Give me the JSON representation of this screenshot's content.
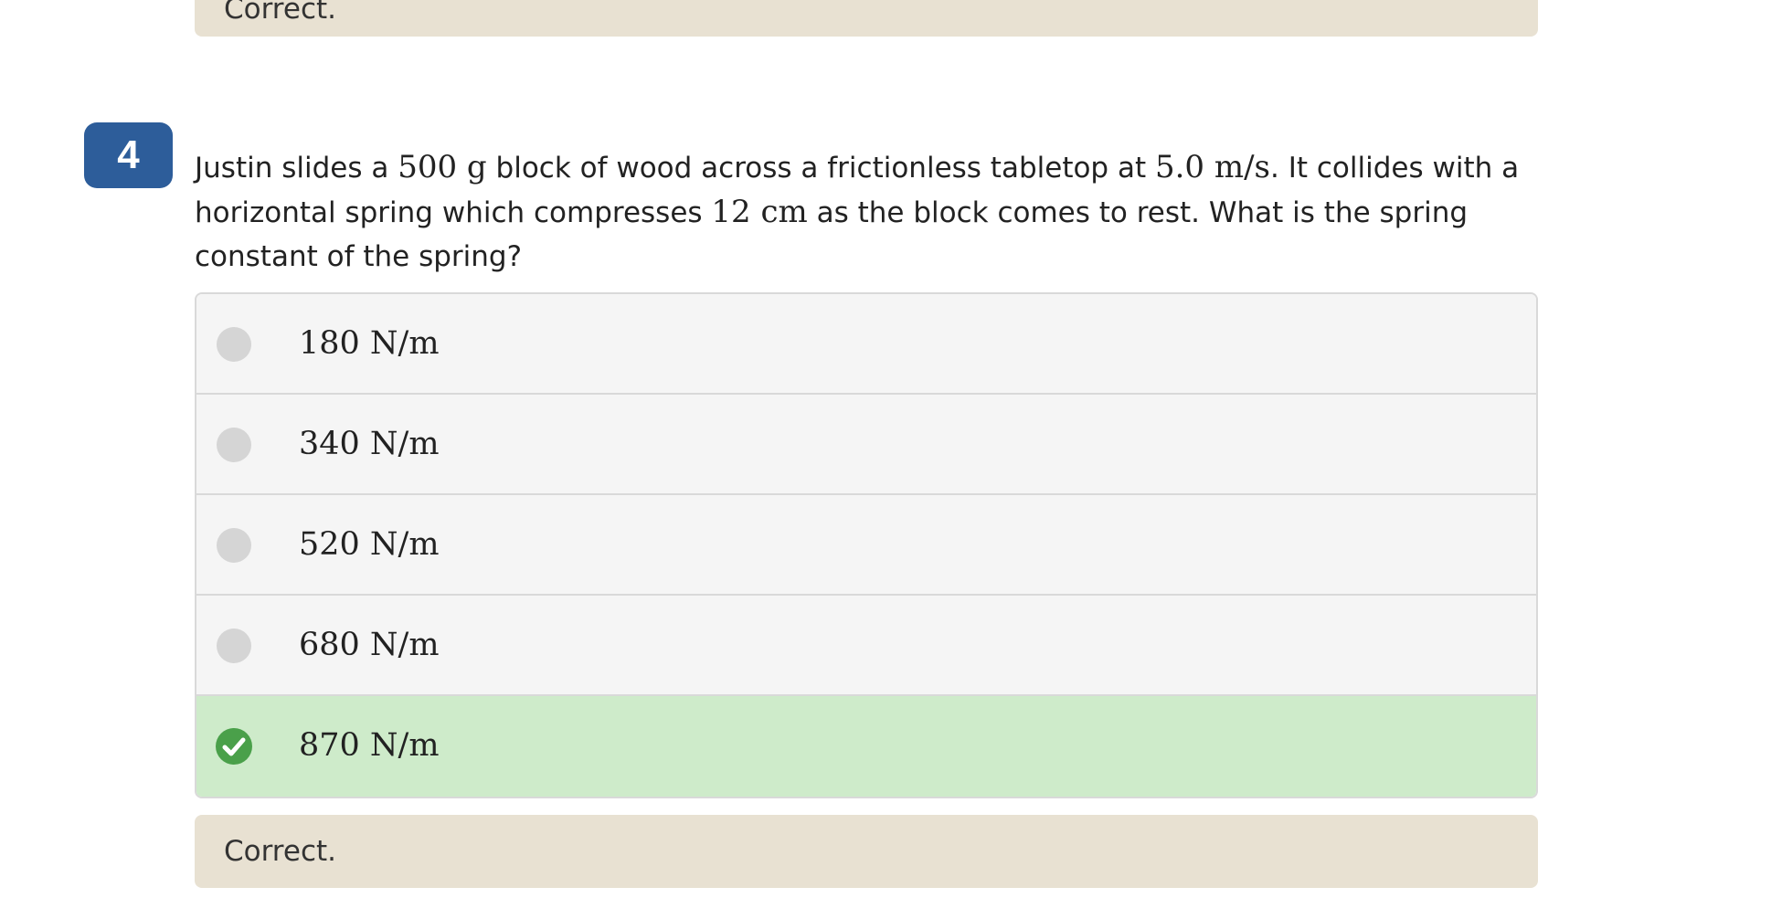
{
  "previous_feedback": {
    "text": "Correct."
  },
  "question": {
    "number": "4",
    "text_parts": {
      "p1": "Justin slides a ",
      "m1": "500 g",
      "p2": " block of wood across a frictionless tabletop at ",
      "m2": "5.0 m/s",
      "p3": ". It collides with a horizontal spring which compresses ",
      "m3": "12 cm",
      "p4": " as the block comes to rest. What is the spring constant of the spring?"
    }
  },
  "choices": [
    {
      "label": "180 N/m",
      "state": "unselected"
    },
    {
      "label": "340 N/m",
      "state": "unselected"
    },
    {
      "label": "520 N/m",
      "state": "unselected"
    },
    {
      "label": "680 N/m",
      "state": "unselected"
    },
    {
      "label": "870 N/m",
      "state": "correct-selected"
    }
  ],
  "feedback": {
    "text": "Correct."
  },
  "colors": {
    "badge": "#2d5d9a",
    "correct_row": "#ceebca",
    "check": "#4aa04a",
    "feedback_bg": "#e8e1d2",
    "choice_bg": "#f5f5f5"
  },
  "icons": {
    "correct": "check-circle-icon",
    "unselected": "radio-icon"
  }
}
